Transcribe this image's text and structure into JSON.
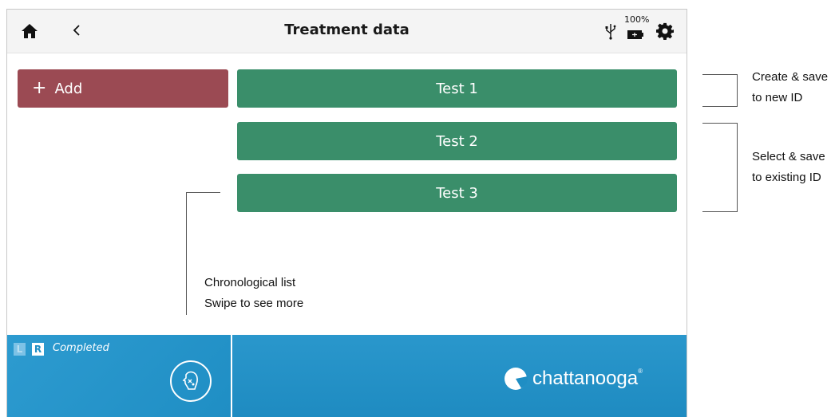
{
  "header": {
    "title": "Treatment data",
    "battery_percent": "100%",
    "icons": [
      "home-icon",
      "back-icon",
      "usb-icon",
      "battery-icon",
      "settings-icon"
    ]
  },
  "actions": {
    "add_label": "Add",
    "add_symbol": "+"
  },
  "tests": [
    "Test 1",
    "Test 2",
    "Test 3"
  ],
  "footer": {
    "side_left": "L",
    "side_right": "R",
    "status": "Completed",
    "brand": "chattanooga",
    "brand_mark": "®"
  },
  "annotations": {
    "create_line1": "Create & save",
    "create_line2": "to new ID",
    "select_line1": "Select & save",
    "select_line2": "to existing ID",
    "list_line1": "Chronological list",
    "list_line2": "Swipe to see more"
  },
  "colors": {
    "add_button": "#9b4a53",
    "test_button": "#3a8e6a",
    "footer": "#1f8ec4"
  }
}
